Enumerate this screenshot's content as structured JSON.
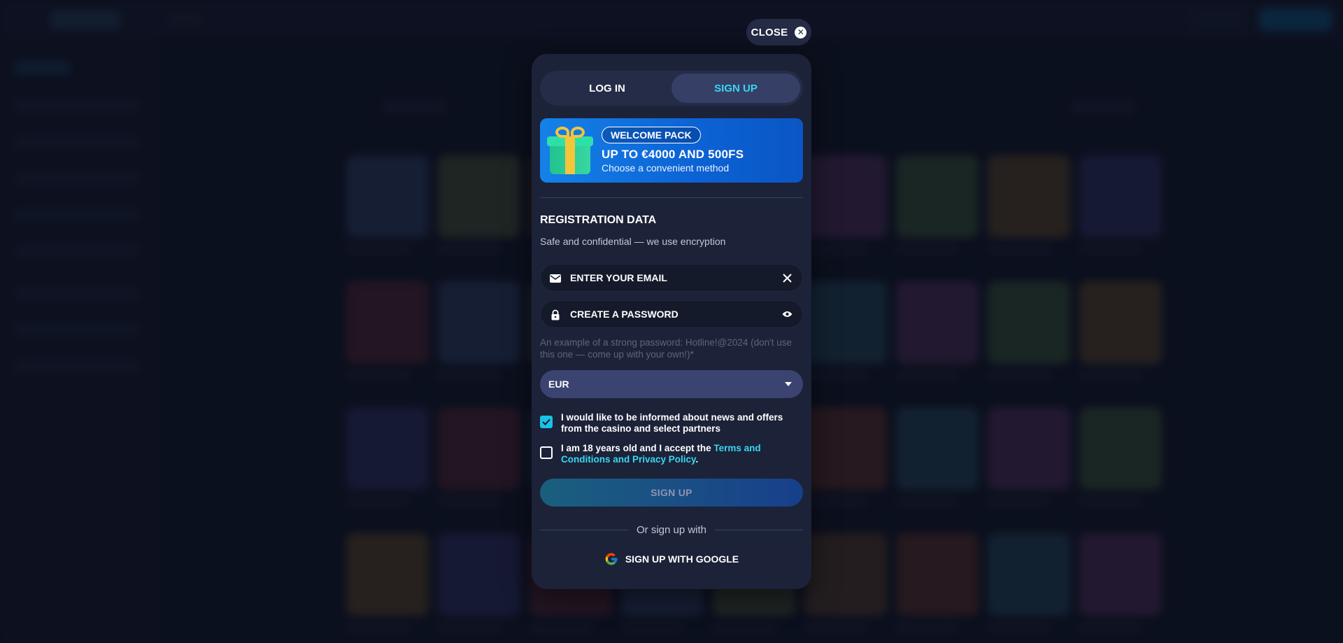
{
  "close": {
    "label": "CLOSE"
  },
  "tabs": [
    {
      "label": "LOG IN",
      "active": false
    },
    {
      "label": "SIGN UP",
      "active": true
    }
  ],
  "promo": {
    "badge": "WELCOME PACK",
    "title": "UP TO €4000 AND 500FS",
    "subtitle": "Choose a convenient method"
  },
  "registration": {
    "title": "REGISTRATION DATA",
    "subtitle": "Safe and confidential — we use encryption"
  },
  "email": {
    "placeholder": "ENTER YOUR EMAIL",
    "value": ""
  },
  "password": {
    "placeholder": "CREATE A PASSWORD",
    "value": "",
    "hint": "An example of a strong password: Hotline!@2024 (don't use this one — come up with your own!)*"
  },
  "currency": {
    "selected": "EUR"
  },
  "consents": {
    "news": {
      "text": "I would like to be informed about news and offers from the casino and select partners",
      "checked": true
    },
    "age": {
      "text": "I am 18 years old and I accept the ",
      "link": "Terms and Conditions and Privacy Policy",
      "suffix": ".",
      "checked": false
    }
  },
  "submit": {
    "label": "SIGN UP"
  },
  "alt_signup": {
    "divider_text": "Or sign up with",
    "google_label": "SIGN UP WITH GOOGLE"
  },
  "colors": {
    "accent": "#38d7f2",
    "modal_bg": "#1c2238",
    "checkbox": "#17c3e6",
    "promo": "#1581e8"
  }
}
